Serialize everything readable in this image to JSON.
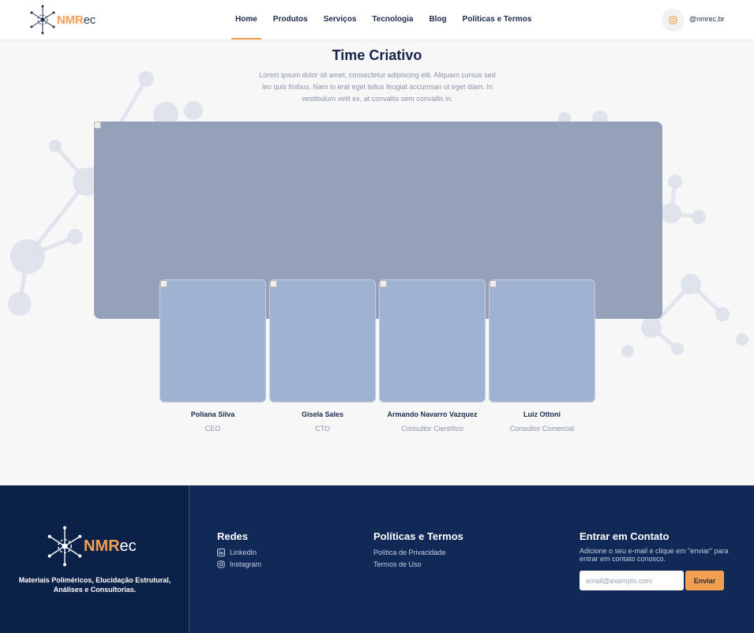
{
  "header": {
    "logo_brand": "NMR",
    "logo_suffix": "ec",
    "nav": [
      {
        "label": "Home",
        "active": true
      },
      {
        "label": "Produtos"
      },
      {
        "label": "Serviços"
      },
      {
        "label": "Tecnologia"
      },
      {
        "label": "Blog"
      },
      {
        "label": "Políticas e Termos"
      }
    ],
    "social_icon": "instagram-icon",
    "social_handle": "@nmrec.br"
  },
  "team": {
    "title": "Time Criativo",
    "description": "Lorem ipsum dolor sit amet, consectetur adipiscing elit. Aliquam cursus sed leo quis finibus. Nam in erat eget tellus feugiat accumsan ut eget diam. In vestibulum velit ex, at convallis sem convallis in.",
    "members": [
      {
        "name": "Poliana Silva",
        "role": "CEO"
      },
      {
        "name": "Gisela Sales",
        "role": "CTO"
      },
      {
        "name": "Armando Navarro Vazquez",
        "role": "Consultor Científico"
      },
      {
        "name": "Luiz Ottoni",
        "role": "Consultor Comercial"
      }
    ]
  },
  "footer": {
    "logo_brand": "NMR",
    "logo_suffix": "ec",
    "tagline": "Materiais Poliméricos, Elucidação Estrutural, Análises e Consultorias.",
    "redes": {
      "title": "Redes",
      "links": [
        {
          "label": "LinkedIn",
          "icon": "linkedin-icon"
        },
        {
          "label": "Instagram",
          "icon": "instagram-icon"
        }
      ]
    },
    "politicas": {
      "title": "Políticas e Termos",
      "links": [
        "Política de Privacidade",
        "Termos de Uso"
      ]
    },
    "contato": {
      "title": "Entrar em Contato",
      "description": "Adicione o seu e-mail e clique em \"enviar\" para entrar em contato conosco.",
      "email_placeholder": "email@exemplo.com",
      "send_label": "Enviar"
    }
  },
  "colors": {
    "accent": "#f0a050",
    "navy": "#112957",
    "navy_dark": "#0c2148",
    "banner": "#94a1b9",
    "card": "#a0b2d2"
  }
}
